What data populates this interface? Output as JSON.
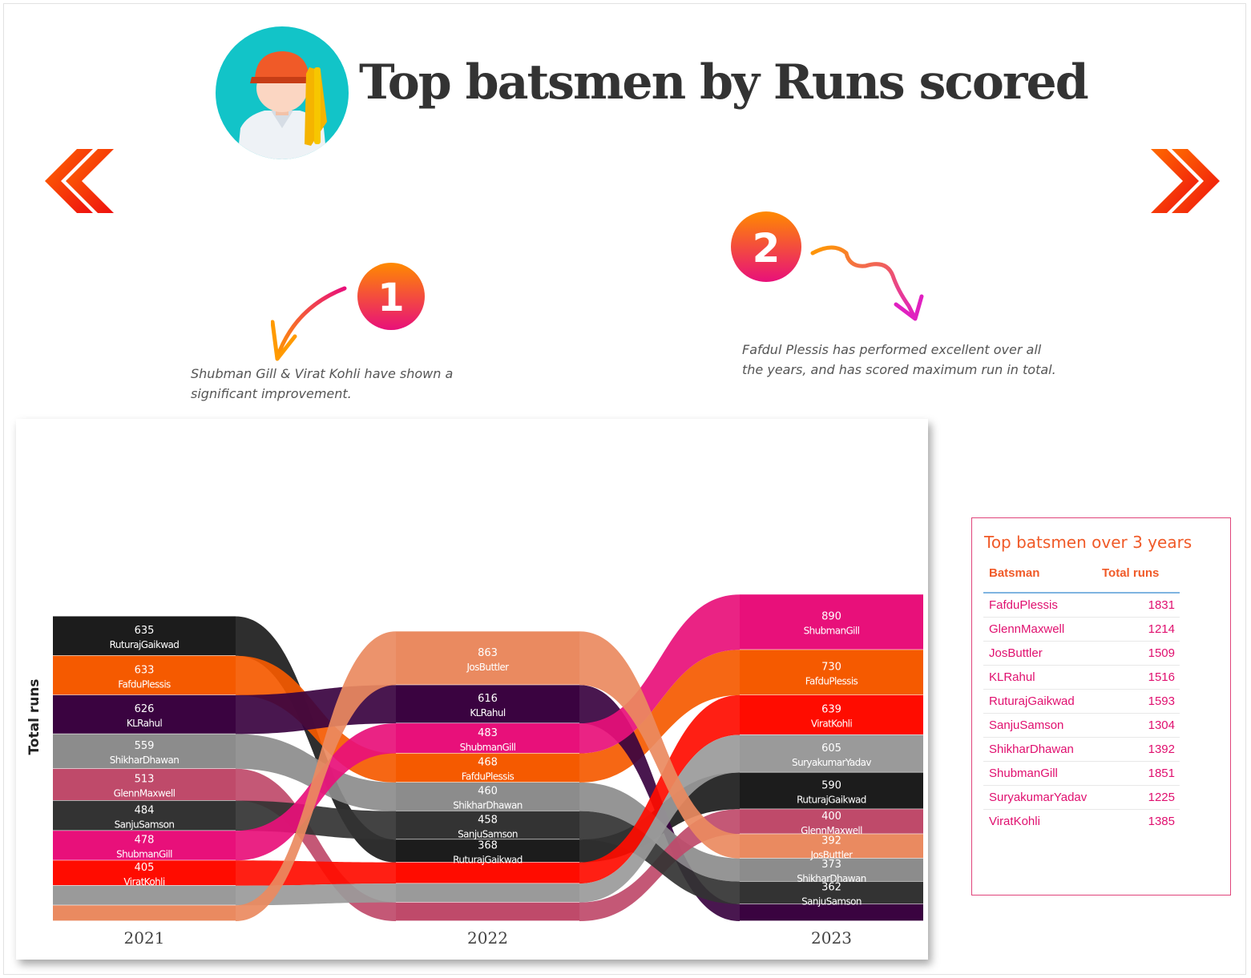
{
  "title": "Top batsmen by Runs scored",
  "annotations": [
    {
      "badge": "1",
      "text": "Shubman Gill & Virat Kohli have shown a significant improvement."
    },
    {
      "badge": "2",
      "text": "Fafdul Plessis has performed excellent over all the years, and has scored maximum run in total."
    }
  ],
  "colors": {
    "RuturajGaikwad": "#1c1c1c",
    "FafduPlessis": "#f55a00",
    "KLRahul": "#3a0340",
    "ShikharDhawan": "#8c8c8c",
    "GlennMaxwell": "#bf4a6a",
    "SanjuSamson": "#333333",
    "ShubmanGill": "#e8107a",
    "ViratKohli": "#ff0c00",
    "SuryakumarYadav": "#9a9a9a",
    "JosButtler": "#ea8a60"
  },
  "chart_data": {
    "type": "bump",
    "ylabel": "Total runs",
    "categories": [
      "2021",
      "2022",
      "2023"
    ],
    "series": [
      {
        "name": "RuturajGaikwad",
        "values": [
          635,
          368,
          590
        ]
      },
      {
        "name": "FafduPlessis",
        "values": [
          633,
          468,
          730
        ]
      },
      {
        "name": "KLRahul",
        "values": [
          626,
          616,
          274
        ]
      },
      {
        "name": "ShikharDhawan",
        "values": [
          559,
          460,
          373
        ]
      },
      {
        "name": "GlennMaxwell",
        "values": [
          513,
          301,
          400
        ]
      },
      {
        "name": "SanjuSamson",
        "values": [
          484,
          458,
          362
        ]
      },
      {
        "name": "ShubmanGill",
        "values": [
          478,
          483,
          890
        ]
      },
      {
        "name": "ViratKohli",
        "values": [
          405,
          341,
          639
        ]
      },
      {
        "name": "SuryakumarYadav",
        "values": [
          317,
          303,
          605
        ]
      },
      {
        "name": "JosButtler",
        "values": [
          254,
          863,
          392
        ]
      }
    ],
    "shown_labels": {
      "2021": [
        "RuturajGaikwad",
        "FafduPlessis",
        "KLRahul",
        "ShikharDhawan",
        "GlennMaxwell",
        "SanjuSamson",
        "ShubmanGill",
        "ViratKohli"
      ],
      "2022": [
        "JosButtler",
        "KLRahul",
        "ShubmanGill",
        "FafduPlessis",
        "ShikharDhawan",
        "SanjuSamson",
        "RuturajGaikwad"
      ],
      "2023": [
        "ShubmanGill",
        "FafduPlessis",
        "ViratKohli",
        "SuryakumarYadav",
        "RuturajGaikwad",
        "GlennMaxwell",
        "JosButtler",
        "ShikharDhawan",
        "SanjuSamson"
      ]
    }
  },
  "table": {
    "title": "Top batsmen over 3 years",
    "col_batsman": "Batsman",
    "col_runs": "Total runs",
    "rows": [
      {
        "name": "FafduPlessis",
        "runs": "1831"
      },
      {
        "name": "GlennMaxwell",
        "runs": "1214"
      },
      {
        "name": "JosButtler",
        "runs": "1509"
      },
      {
        "name": "KLRahul",
        "runs": "1516"
      },
      {
        "name": "RuturajGaikwad",
        "runs": "1593"
      },
      {
        "name": "SanjuSamson",
        "runs": "1304"
      },
      {
        "name": "ShikharDhawan",
        "runs": "1392"
      },
      {
        "name": "ShubmanGill",
        "runs": "1851"
      },
      {
        "name": "SuryakumarYadav",
        "runs": "1225"
      },
      {
        "name": "ViratKohli",
        "runs": "1385"
      }
    ]
  }
}
